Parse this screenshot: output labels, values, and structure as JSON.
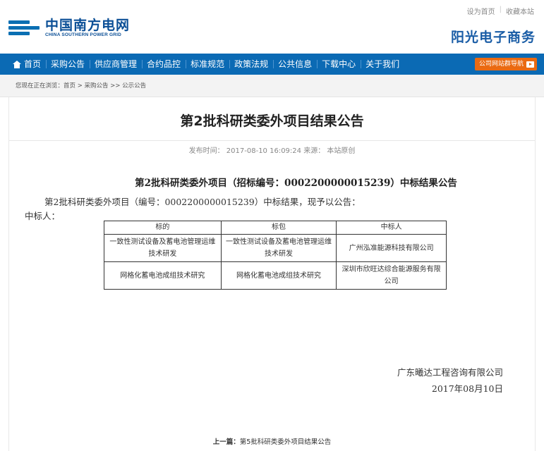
{
  "header": {
    "logo_cn": "中国南方电网",
    "logo_en": "CHINA SOUTHERN POWER GRID",
    "top_links": [
      "设为首页",
      "收藏本站"
    ],
    "brand": "阳光电子商务"
  },
  "nav": {
    "items": [
      "首页",
      "采购公告",
      "供应商管理",
      "合约品控",
      "标准规范",
      "政策法规",
      "公共信息",
      "下载中心",
      "关于我们"
    ],
    "site_nav_label": "公司网站群导航"
  },
  "breadcrumb": "您现在正在浏览：首页 > 采购公告 >> 公示公告",
  "article": {
    "title": "第2批科研类委外项目结果公告",
    "meta": "发布时间： 2017-08-10 16:09:24  来源： 本站原创",
    "heading": "第2批科研类委外项目（招标编号：0002200000015239）中标结果公告",
    "intro": "第2批科研类委外项目（编号：0002200000015239）中标结果，现予以公告：",
    "winner_label": "中标人：",
    "table": {
      "headers": [
        "标的",
        "标包",
        "中标人"
      ],
      "rows": [
        [
          "一致性测试设备及蓄电池管理运维技术研发",
          "一致性测试设备及蓄电池管理运维技术研发",
          "广州泓准能源科技有限公司"
        ],
        [
          "网格化蓄电池成组技术研究",
          "网格化蓄电池成组技术研究",
          "深圳市欣旺达综合能源服务有限公司"
        ]
      ]
    },
    "company": "广东曦达工程咨询有限公司",
    "date": "2017年08月10日",
    "prev_label": "上一篇：",
    "prev_title": "第5批科研类委外项目结果公告"
  },
  "colors": {
    "nav_bg": "#0b6ab4",
    "brand_blue": "#1a5da6",
    "accent_orange": "#ea6a12"
  }
}
